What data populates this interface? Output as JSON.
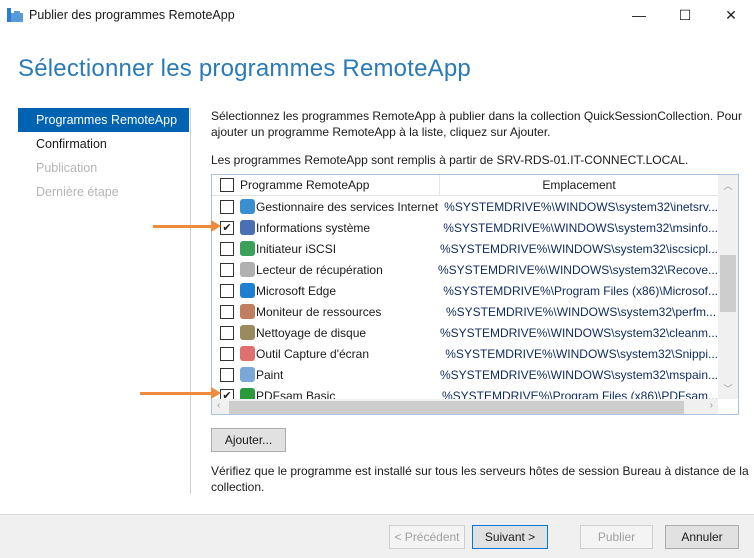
{
  "window": {
    "title": "Publier des programmes RemoteApp",
    "minimize": "—",
    "maximize": "☐",
    "close": "✕"
  },
  "page_title": "Sélectionner les programmes RemoteApp",
  "nav": [
    {
      "label": "Programmes RemoteApp",
      "state": "selected"
    },
    {
      "label": "Confirmation",
      "state": "enabled"
    },
    {
      "label": "Publication",
      "state": "disabled"
    },
    {
      "label": "Dernière étape",
      "state": "disabled"
    }
  ],
  "intro": {
    "line1": "Sélectionnez les programmes RemoteApp à publier dans la collection QuickSessionCollection. Pour",
    "line2": "ajouter un programme RemoteApp à la liste, cliquez sur Ajouter.",
    "source": "Les programmes RemoteApp sont remplis à partir de SRV-RDS-01.IT-CONNECT.LOCAL."
  },
  "table": {
    "columns": [
      "Programme RemoteApp",
      "Emplacement"
    ],
    "rows": [
      {
        "name": "Gestionnaire des services Internet",
        "path": "%SYSTEMDRIVE%\\WINDOWS\\system32\\inetsrv...",
        "checked": false,
        "icon": "iis-icon",
        "color": "#3a8fd0"
      },
      {
        "name": "Informations système",
        "path": "%SYSTEMDRIVE%\\WINDOWS\\system32\\msinfo...",
        "checked": true,
        "icon": "system-info-icon",
        "color": "#4a6fb5"
      },
      {
        "name": "Initiateur iSCSI",
        "path": "%SYSTEMDRIVE%\\WINDOWS\\system32\\iscsicpl...",
        "checked": false,
        "icon": "iscsi-icon",
        "color": "#3aa05a"
      },
      {
        "name": "Lecteur de récupération",
        "path": "%SYSTEMDRIVE%\\WINDOWS\\system32\\Recove...",
        "checked": false,
        "icon": "drive-icon",
        "color": "#b0b0b0"
      },
      {
        "name": "Microsoft Edge",
        "path": "%SYSTEMDRIVE%\\Program Files (x86)\\Microsof...",
        "checked": false,
        "icon": "edge-icon",
        "color": "#1f7fd0"
      },
      {
        "name": "Moniteur de ressources",
        "path": "%SYSTEMDRIVE%\\WINDOWS\\system32\\perfm...",
        "checked": false,
        "icon": "resource-monitor-icon",
        "color": "#c08060"
      },
      {
        "name": "Nettoyage de disque",
        "path": "%SYSTEMDRIVE%\\WINDOWS\\system32\\cleanm...",
        "checked": false,
        "icon": "disk-cleanup-icon",
        "color": "#9a8a60"
      },
      {
        "name": "Outil Capture d'écran",
        "path": "%SYSTEMDRIVE%\\WINDOWS\\system32\\Snippi...",
        "checked": false,
        "icon": "snipping-tool-icon",
        "color": "#e07070"
      },
      {
        "name": "Paint",
        "path": "%SYSTEMDRIVE%\\WINDOWS\\system32\\mspain...",
        "checked": false,
        "icon": "paint-icon",
        "color": "#7aa8d8"
      },
      {
        "name": "PDFsam Basic",
        "path": "%SYSTEMDRIVE%\\Program Files (x86)\\PDFsam...",
        "checked": true,
        "icon": "pdfsam-icon",
        "color": "#2a9a3a"
      }
    ]
  },
  "add_button": "Ajouter...",
  "note_line1": "Vérifiez que le programme est installé sur tous les serveurs hôtes de session Bureau à distance de la",
  "note_line2": "collection.",
  "footer": {
    "previous": "< Précédent",
    "next": "Suivant >",
    "publish": "Publier",
    "cancel": "Annuler"
  },
  "colors": {
    "accent": "#0063b1",
    "title": "#2a7ab8",
    "annotation_arrow": "#f08a3c"
  }
}
